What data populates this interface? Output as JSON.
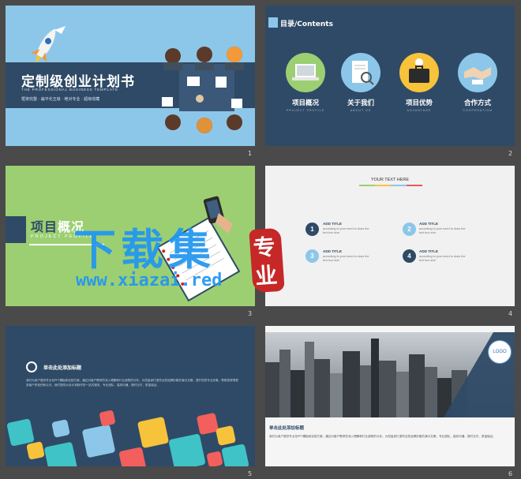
{
  "slides": [
    {
      "number": "1",
      "title": "定制级创业计划书",
      "subtitle": "THE PROFESSIONAL BUSINESS TEMPLATE",
      "tagline": "框架完整 · 扁平化五级 · 绝对专业 · 超级收藏"
    },
    {
      "number": "2",
      "heading": "目录/Contents",
      "items": [
        {
          "label": "项目概况",
          "sub": "PROJECT PROFILE",
          "icon": "laptop-icon"
        },
        {
          "label": "关于我们",
          "sub": "ABOUT US",
          "icon": "document-search-icon"
        },
        {
          "label": "项目优势",
          "sub": "ADVANTAGE",
          "icon": "briefcase-icon"
        },
        {
          "label": "合作方式",
          "sub": "COOPERATION",
          "icon": "handshake-icon"
        }
      ]
    },
    {
      "number": "3",
      "title_a": "项目",
      "title_b": "概况",
      "subtitle": "PROJECT PEOFILE"
    },
    {
      "number": "4",
      "header": "YOUR TEXT HERE",
      "items": [
        {
          "n": "1",
          "title": "ADD TITLE",
          "desc": "according to your need to draw the text box size"
        },
        {
          "n": "2",
          "title": "ADD TITLE",
          "desc": "according to your need to draw the text box size"
        },
        {
          "n": "3",
          "title": "ADD TITLE",
          "desc": "according to your need to draw the text box size"
        },
        {
          "n": "4",
          "title": "ADD TITLE",
          "desc": "according to your need to draw the text box size"
        }
      ]
    },
    {
      "number": "5",
      "title": "单击此处添加标题",
      "body": "我们为用户提供专业化PPT模板和定制方案，通过对客户需求的深入理解和行业趋势的分析，为您量身打造符合您品牌形象的演示文稿，提升您的专业形象，帮助您获得更多客户的信任和认可。我们提供从设计到制作的一站式服务，专业团队，高效沟通，按时交付，质量保证。"
    },
    {
      "number": "6",
      "title": "单击此处添加标题",
      "logo": "LOGO",
      "body": "我们为用户提供专业化PPT模板和定制方案，通过对客户需求的深入理解和行业趋势的分析，为您量身打造符合您品牌形象的演示文稿，专业团队，高效沟通，按时交付，质量保证。"
    }
  ],
  "watermark": {
    "cn": "下载集",
    "seal": "专业",
    "url": "www.xiazai.red"
  },
  "colors": {
    "navy": "#2f4a66",
    "sky": "#8cc7e9",
    "green": "#9ccf72",
    "watermark": "#2196f0",
    "seal": "#c62828"
  }
}
